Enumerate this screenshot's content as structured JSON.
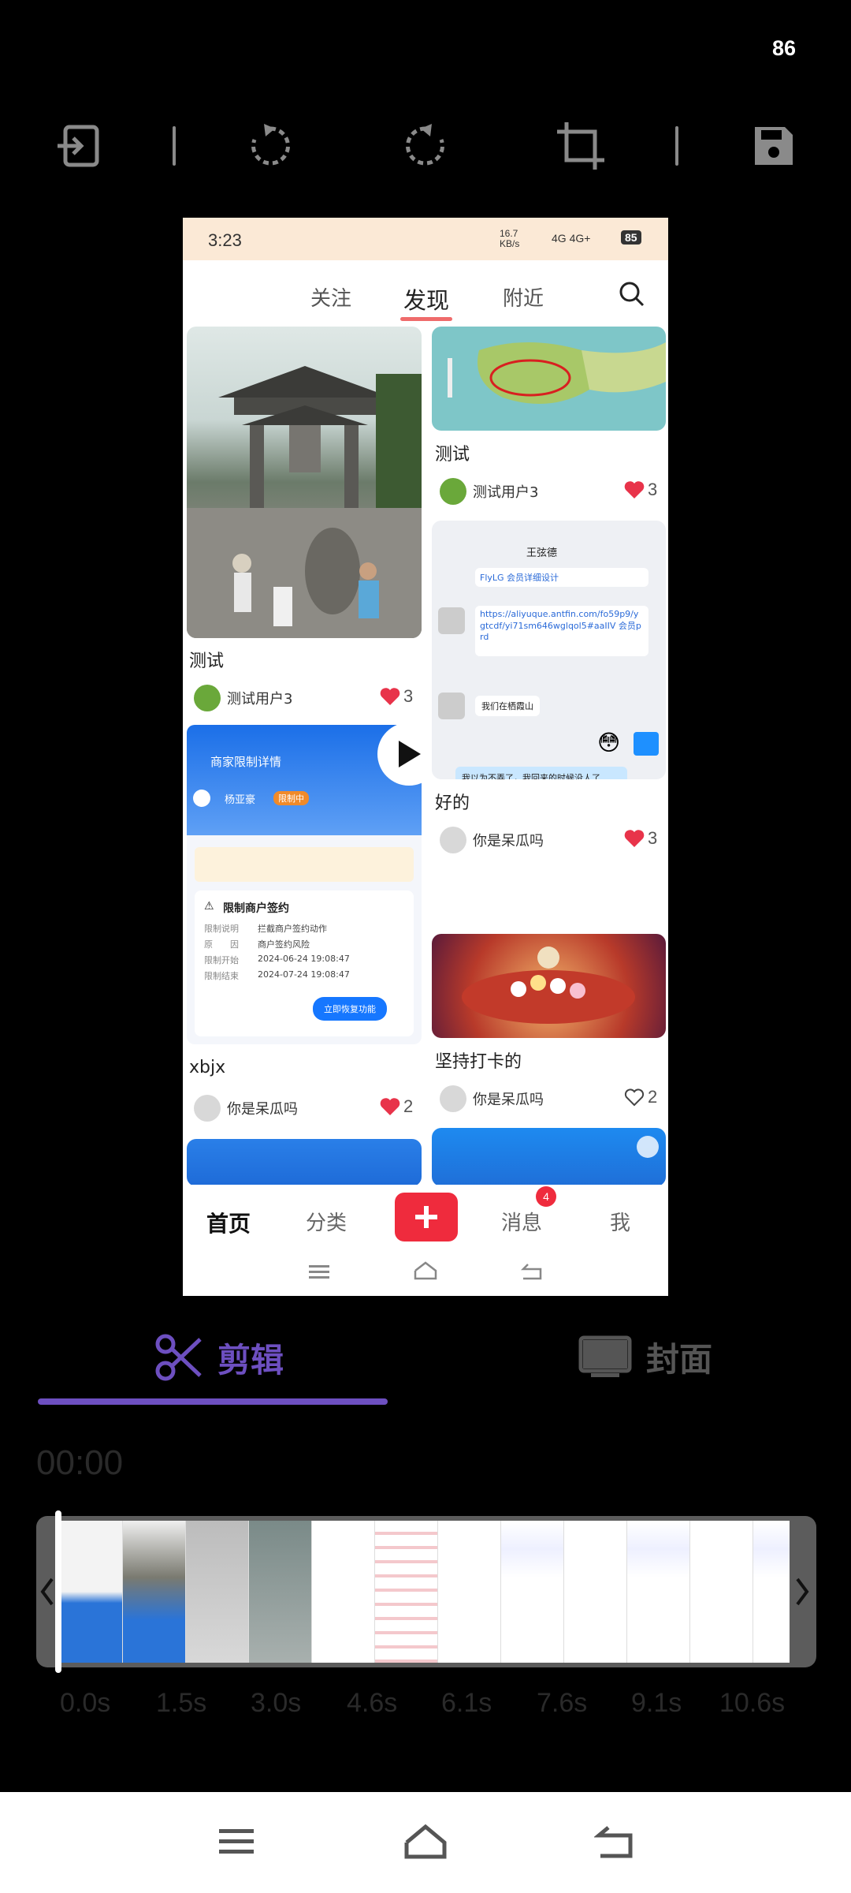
{
  "status_bar": {
    "battery": "86"
  },
  "toolbar": {
    "icons": [
      "exit-icon",
      "rotate-left-icon",
      "rotate-right-icon",
      "crop-icon",
      "save-icon"
    ]
  },
  "preview": {
    "status": {
      "time": "3:23",
      "speed": "16.7 KB/s",
      "network": "4G 4G+",
      "battery": "85"
    },
    "tabs": [
      "关注",
      "发现",
      "附近"
    ],
    "active_tab": "发现",
    "cards": [
      {
        "title": "测试",
        "user": "测试用户3",
        "likes": "3",
        "liked": true
      },
      {
        "title": "测试",
        "user": "测试用户3",
        "likes": "3",
        "liked": true
      },
      {
        "title": "xbjx",
        "user": "你是呆瓜吗",
        "likes": "2",
        "liked": true
      },
      {
        "title": "好的",
        "user": "你是呆瓜吗",
        "likes": "3",
        "liked": true
      },
      {
        "title": "坚持打卡的",
        "user": "你是呆瓜吗",
        "likes": "2",
        "liked": false
      }
    ],
    "chat_card": {
      "contact": "王弦德",
      "lines": [
        "FlyLG 会员详细设计",
        "https://aliyuque.antfin.com/fo59p9/ygtcdf/yi71sm646wglqol5#aaIIV 会员prd",
        "我们在栖霞山",
        "我以为不弄了，我回来的时候没人了"
      ]
    },
    "restrict_card": {
      "header": "商家限制详情",
      "name": "杨亚豪",
      "badge": "限制中",
      "title": "限制商户签约",
      "rows": [
        [
          "限制说明",
          "拦截商户签约动作"
        ],
        [
          "原　　因",
          "商户签约风险"
        ],
        [
          "限制开始",
          "2024-06-24 19:08:47"
        ],
        [
          "限制结束",
          "2024-07-24 19:08:47"
        ]
      ],
      "button": "立即恢复功能"
    },
    "bottom_nav": [
      "首页",
      "分类",
      "消息",
      "我"
    ],
    "message_badge": "4"
  },
  "editor": {
    "tabs": [
      "剪辑",
      "封面"
    ],
    "current_time": "00:00",
    "ticks": [
      "0.0s",
      "1.5s",
      "3.0s",
      "4.6s",
      "6.1s",
      "7.6s",
      "9.1s",
      "10.6s"
    ],
    "colors": {
      "accent": "#6d4fc0"
    }
  }
}
